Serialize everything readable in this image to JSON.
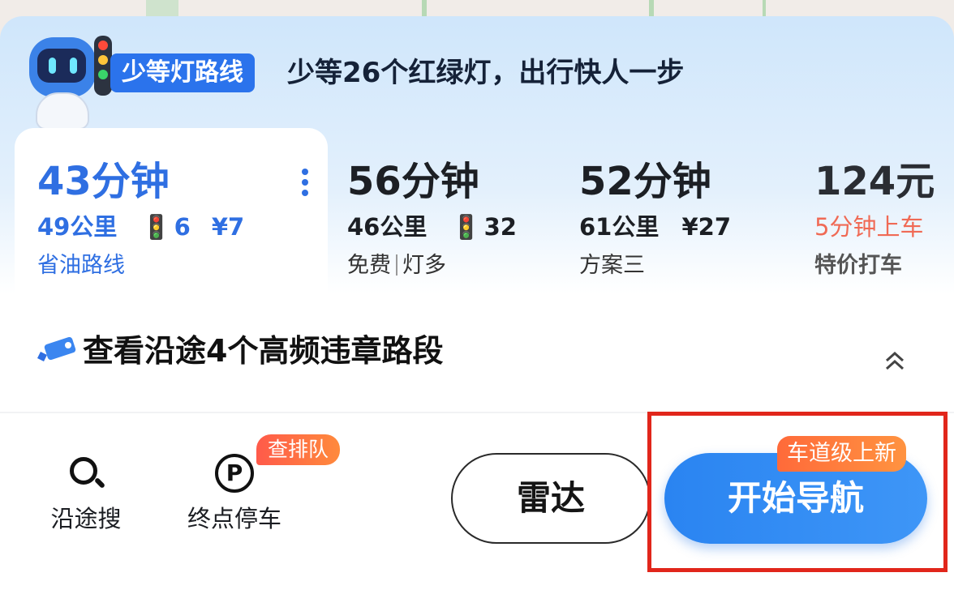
{
  "banner": {
    "tag": "少等灯路线",
    "text": "少等26个红绿灯，出行快人一步"
  },
  "routes": [
    {
      "time": "43分钟",
      "distance": "49公里",
      "lights": "6",
      "toll": "¥7",
      "desc": "省油路线",
      "selected": true
    },
    {
      "time": "56分钟",
      "distance": "46公里",
      "lights": "32",
      "desc_a": "免费",
      "desc_b": "灯多"
    },
    {
      "time": "52分钟",
      "distance": "61公里",
      "toll": "¥27",
      "desc": "方案三"
    },
    {
      "time": "124元",
      "pickup": "5分钟上车",
      "desc": "特价打车"
    }
  ],
  "violation": {
    "text": "查看沿途4个高频违章路段"
  },
  "toolbar": {
    "search_label": "沿途搜",
    "parking_label": "终点停车",
    "queue_badge": "查排队",
    "radar_label": "雷达",
    "nav_label": "开始导航",
    "nav_badge": "车道级上新"
  },
  "colors": {
    "accent": "#2f6fe2",
    "nav_button": "#2a84f1",
    "badge_orange": "#ff7a3c",
    "highlight_frame": "#e1261b",
    "taxi_pickup": "#f06a55"
  },
  "icons": [
    "robot-mascot-icon",
    "traffic-light-icon",
    "more-vertical-icon",
    "camera-icon",
    "chevron-up-double-icon",
    "search-icon",
    "parking-icon"
  ]
}
